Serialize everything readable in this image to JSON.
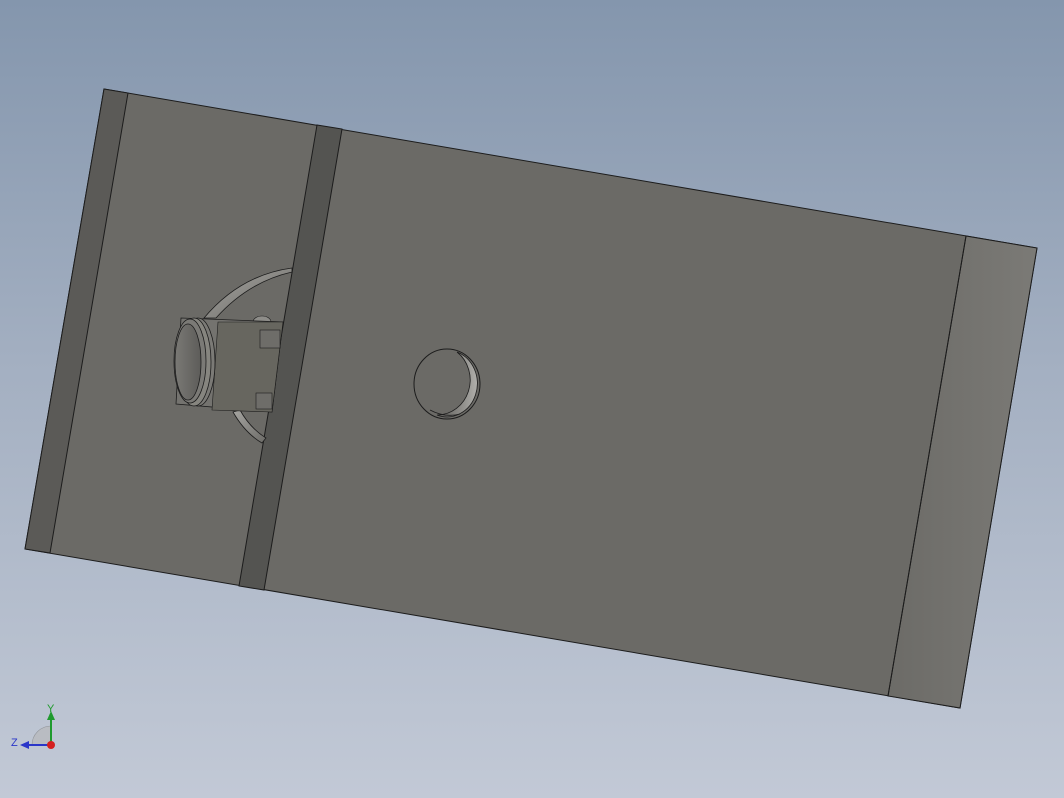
{
  "viewport": {
    "background_top": "#8496ad",
    "background_bottom": "#c2c9d6"
  },
  "model": {
    "face_color": "#6b6a66",
    "band_color": "#545451",
    "edge_color": "#1c1c1c",
    "end_face_color": "#777672"
  },
  "triad": {
    "y_label": "Y",
    "z_label": "Z",
    "y_color": "#1f9a2e",
    "z_color": "#2a36c9",
    "x_color": "#d42020"
  }
}
